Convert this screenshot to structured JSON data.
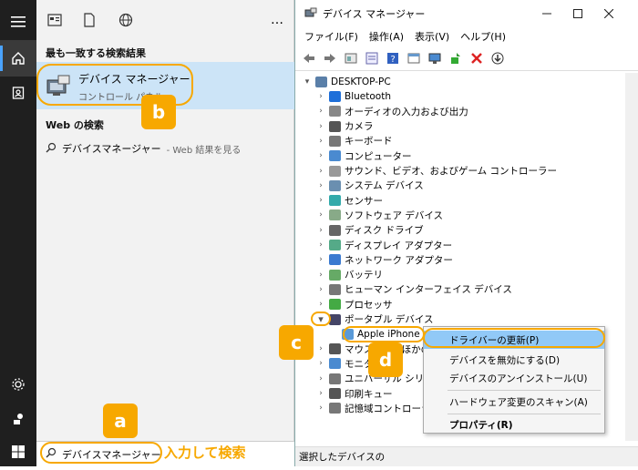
{
  "start_panel": {
    "best_match_header": "最も一致する検索結果",
    "best_match_title": "デバイス マネージャー",
    "best_match_subtitle": "コントロール パネル",
    "web_header": "Web の検索",
    "web_item_label": "デバイスマネージャー",
    "web_item_sub": "- Web 結果を見る",
    "more_label": "…",
    "search_value": "デバイスマネージャー",
    "hint": "入力して検索"
  },
  "callouts": {
    "a": "a",
    "b": "b",
    "c": "c",
    "d": "d"
  },
  "device_manager": {
    "title": "デバイス マネージャー",
    "menu": [
      "ファイル(F)",
      "操作(A)",
      "表示(V)",
      "ヘルプ(H)"
    ],
    "root": "DESKTOP-PC",
    "nodes": [
      "Bluetooth",
      "オーディオの入力および出力",
      "カメラ",
      "キーボード",
      "コンピューター",
      "サウンド、ビデオ、およびゲーム コントローラー",
      "システム デバイス",
      "センサー",
      "ソフトウェア デバイス",
      "ディスク ドライブ",
      "ディスプレイ アダプター",
      "ネットワーク アダプター",
      "バッテリ",
      "ヒューマン インターフェイス デバイス",
      "プロセッサ",
      "ポータブル デバイス",
      "Apple iPhone",
      "マウスとそのほかのポインティング デバイス",
      "モニター",
      "ユニバーサル シリアル バス コントローラー",
      "印刷キュー",
      "記憶域コントローラー"
    ],
    "status": "選択したデバイスの"
  },
  "context_menu": {
    "items": [
      "ドライバーの更新(P)",
      "デバイスを無効にする(D)",
      "デバイスのアンインストール(U)",
      "ハードウェア変更のスキャン(A)",
      "プロパティ(R)"
    ]
  },
  "colors": {
    "accent": "#f7a800",
    "selection": "#cce4f7",
    "menu_highlight": "#91c9f7",
    "taskbar": "#1f1f1f"
  }
}
